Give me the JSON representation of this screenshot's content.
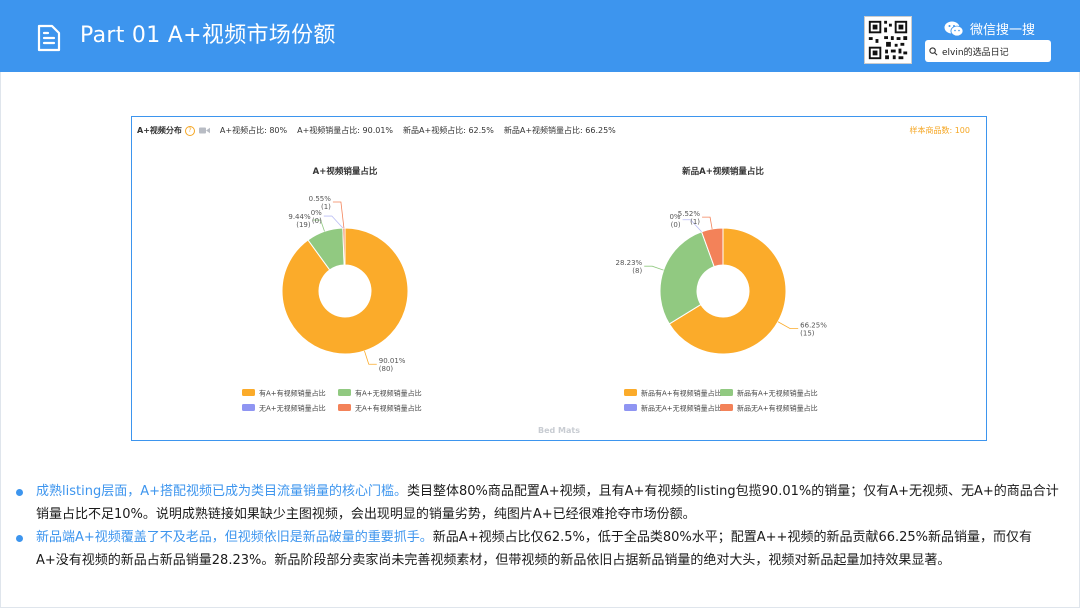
{
  "header": {
    "title": "Part 01  A+视频市场份额",
    "wechat_label": "微信搜一搜",
    "search_text": "elvin的选品日记"
  },
  "chart_header": {
    "label": "A+视频分布",
    "metrics": [
      "A+视频占比: 80%",
      "A+视频销量占比: 90.01%",
      "新品A+视频占比: 62.5%",
      "新品A+视频销量占比: 66.25%"
    ],
    "sample": "样本商品数: 100",
    "watermark": "Bed Mats"
  },
  "colors": {
    "header_bg": "#3d95ee",
    "orange": "#fbab2a",
    "green": "#91c981",
    "purple": "#8f95f2",
    "red": "#f38259"
  },
  "chart_data": [
    {
      "type": "pie",
      "title": "A+视频销量占比",
      "donut": true,
      "slices": [
        {
          "label": "有A+有视频销量占比",
          "percent": 90.01,
          "count": 80,
          "color": "#fbab2a"
        },
        {
          "label": "有A+无视频销量占比",
          "percent": 9.44,
          "count": 19,
          "color": "#91c981"
        },
        {
          "label": "无A+无视频销量占比",
          "percent": 0,
          "count": 0,
          "color": "#8f95f2"
        },
        {
          "label": "无A+有视频销量占比",
          "percent": 0.55,
          "count": 1,
          "color": "#f38259"
        }
      ],
      "legend": "bottom"
    },
    {
      "type": "pie",
      "title": "新品A+视频销量占比",
      "donut": true,
      "slices": [
        {
          "label": "新品有A+有视频销量占比",
          "percent": 66.25,
          "count": 15,
          "color": "#fbab2a"
        },
        {
          "label": "新品有A+无视频销量占比",
          "percent": 28.23,
          "count": 8,
          "color": "#91c981"
        },
        {
          "label": "新品无A+无视频销量占比",
          "percent": 0,
          "count": 0,
          "color": "#8f95f2"
        },
        {
          "label": "新品无A+有视频销量占比",
          "percent": 5.52,
          "count": 1,
          "color": "#f38259"
        }
      ],
      "legend": "bottom"
    }
  ],
  "bullets": [
    {
      "highlight": "成熟listing层面，A+搭配视频已成为类目流量销量的核心门槛。",
      "text": "类目整体80%商品配置A+视频，且有A+有视频的listing包揽90.01%的销量；仅有A+无视频、无A+的商品合计销量占比不足10%。说明成熟链接如果缺少主图视频，会出现明显的销量劣势，纯图片A+已经很难抢夺市场份额。"
    },
    {
      "highlight": "新品端A+视频覆盖了不及老品，但视频依旧是新品破量的重要抓手。",
      "text": "新品A+视频占比仅62.5%，低于全品类80%水平；配置A++视频的新品贡献66.25%新品销量，而仅有A+没有视频的新品占新品销量28.23%。新品阶段部分卖家尚未完善视频素材，但带视频的新品依旧占据新品销量的绝对大头，视频对新品起量加持效果显著。"
    }
  ]
}
